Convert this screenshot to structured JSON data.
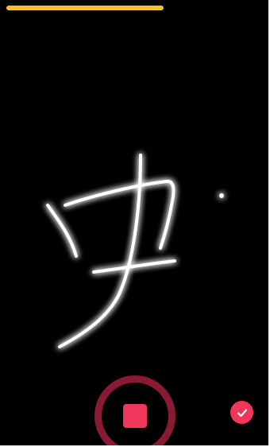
{
  "progress": {
    "fraction": 0.62,
    "color": "#f2c12e"
  },
  "drawing": {
    "stroke_color": "#ffffff",
    "glow_color": "#ffffff"
  },
  "controls": {
    "record_icon": "stop-square-icon",
    "record_ring_color": "#8a1a33",
    "record_fill_color": "#f0365a",
    "confirm_icon": "checkmark-icon",
    "confirm_color": "#f0365a",
    "confirm_glyph_color": "#ffffff"
  }
}
